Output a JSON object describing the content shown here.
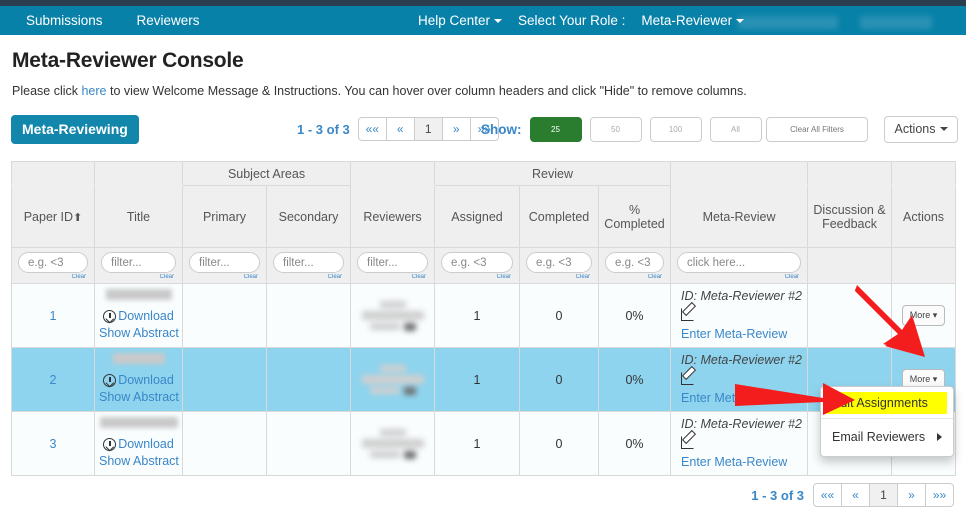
{
  "navbar": {
    "left_items": [
      {
        "label": "Submissions",
        "name": "nav-submissions"
      },
      {
        "label": "Reviewers",
        "name": "nav-reviewers"
      }
    ],
    "help_center": "Help Center",
    "select_role_label": "Select Your Role :",
    "current_role": "Meta-Reviewer",
    "brand_color": "#0881a8",
    "top_strip_color": "#2b3d4f"
  },
  "page": {
    "title": "Meta-Reviewer Console",
    "instructions_before": "Please click ",
    "instructions_link": "here",
    "instructions_after": " to view Welcome Message & Instructions. You can hover over column headers and click \"Hide\" to remove columns."
  },
  "toolbar": {
    "tab_label": "Meta-Reviewing",
    "range_text": "1 - 3 of 3",
    "pager": [
      "««",
      "«",
      "1",
      "»",
      "»»"
    ],
    "show_label": "Show:",
    "page_sizes": [
      "25",
      "50",
      "100",
      "All"
    ],
    "page_size_selected": "25",
    "clear_all_filters": "Clear All Filters",
    "actions": "Actions",
    "selected_color": "#2a7d2e"
  },
  "table": {
    "group_headers": {
      "subject_areas": "Subject Areas",
      "review": "Review"
    },
    "columns": [
      "Paper ID",
      "Title",
      "Primary",
      "Secondary",
      "Reviewers",
      "Assigned",
      "Completed",
      "% Completed",
      "Meta-Review",
      "Discussion & Feedback",
      "Actions"
    ],
    "sort_indicator": "⬆",
    "filters": [
      {
        "placeholder": "e.g. <3",
        "clear": "Clear"
      },
      {
        "placeholder": "filter...",
        "clear": "Clear"
      },
      {
        "placeholder": "filter...",
        "clear": "Clear"
      },
      {
        "placeholder": "filter...",
        "clear": "Clear"
      },
      {
        "placeholder": "filter...",
        "clear": "Clear"
      },
      {
        "placeholder": "e.g. <3",
        "clear": "Clear"
      },
      {
        "placeholder": "e.g. <3",
        "clear": "Clear"
      },
      {
        "placeholder": "e.g. <3",
        "clear": "Clear"
      },
      {
        "placeholder": "click here...",
        "clear": "Clear"
      }
    ],
    "row_links": {
      "download": "Download",
      "show_abstract": "Show Abstract",
      "enter_meta_review": "Enter Meta-Review",
      "more": "More"
    },
    "rows": [
      {
        "paper_id": "1",
        "title_redacted_width": 66,
        "primary": "",
        "secondary": "",
        "assigned": "1",
        "completed": "0",
        "percent_completed": "0%",
        "meta_review_id": "ID: Meta-Reviewer #2",
        "selected": false
      },
      {
        "paper_id": "2",
        "title_redacted_width": 52,
        "primary": "",
        "secondary": "",
        "assigned": "1",
        "completed": "0",
        "percent_completed": "0%",
        "meta_review_id": "ID: Meta-Reviewer #2",
        "selected": true
      },
      {
        "paper_id": "3",
        "title_redacted_width": 78,
        "primary": "",
        "secondary": "",
        "assigned": "1",
        "completed": "0",
        "percent_completed": "0%",
        "meta_review_id": "ID: Meta-Reviewer #2",
        "selected": false
      }
    ]
  },
  "dropdown": {
    "items": [
      {
        "label": "Edit Assignments",
        "highlighted": true,
        "submenu": false
      },
      {
        "label": "Email Reviewers",
        "highlighted": false,
        "submenu": true
      }
    ],
    "highlight_color": "#ffff00"
  },
  "bottom_pager": {
    "range_text": "1 - 3 of 3",
    "pager": [
      "««",
      "«",
      "1",
      "»",
      "»»"
    ]
  },
  "annotations": {
    "arrow_color": "#f41d1d",
    "arrow_count": 2
  }
}
